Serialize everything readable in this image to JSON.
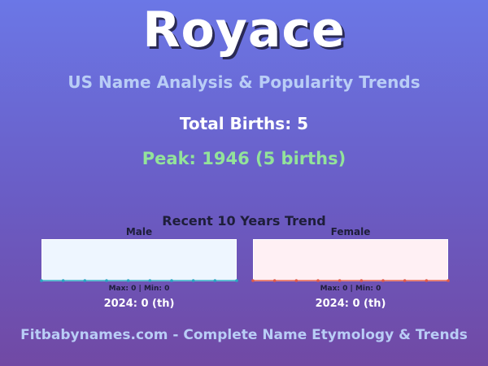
{
  "header": {
    "title": "Royace",
    "subtitle": "US Name Analysis & Popularity Trends",
    "total_births": "Total Births: 5",
    "peak": "Peak: 1946 (5 births)"
  },
  "trend": {
    "title": "Recent 10 Years Trend",
    "male": {
      "label": "Male",
      "maxmin": "Max: 0 | Min: 0",
      "rank": "2024: 0 (th)",
      "values": [
        0,
        0,
        0,
        0,
        0,
        0,
        0,
        0,
        0,
        0
      ],
      "line_color": "#2aa6c2",
      "fill_color": "#eef6ff"
    },
    "female": {
      "label": "Female",
      "maxmin": "Max: 0 | Min: 0",
      "rank": "2024: 0 (th)",
      "values": [
        0,
        0,
        0,
        0,
        0,
        0,
        0,
        0,
        0,
        0
      ],
      "line_color": "#e05a4a",
      "fill_color": "#fff0f4"
    }
  },
  "footer": {
    "text": "Fitbabynames.com - Complete Name Etymology & Trends"
  }
}
